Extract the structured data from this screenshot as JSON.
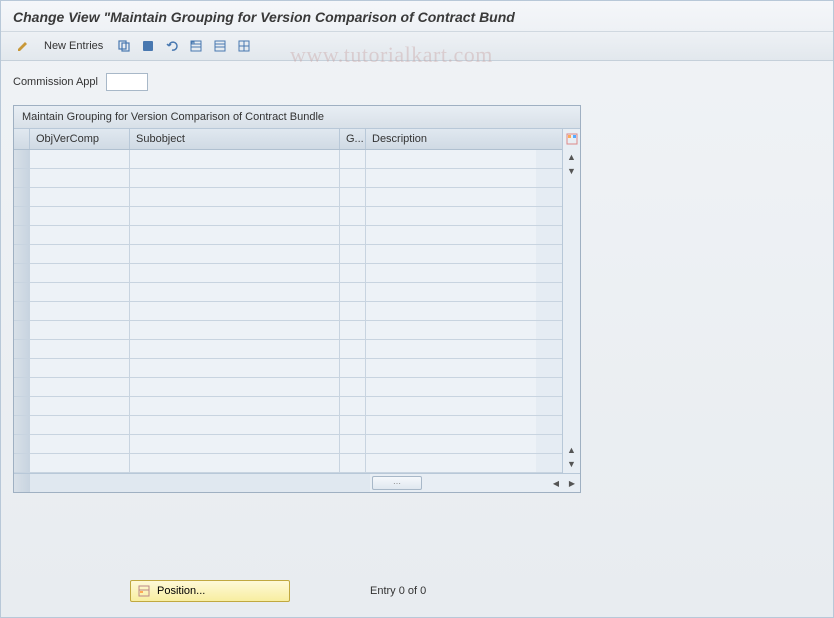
{
  "title": "Change View \"Maintain Grouping for Version Comparison of Contract Bund",
  "toolbar": {
    "new_entries_label": "New Entries"
  },
  "watermark": "www.tutorialkart.com",
  "fields": {
    "commission_appl": {
      "label": "Commission Appl",
      "value": ""
    }
  },
  "table": {
    "title": "Maintain Grouping for Version Comparison of Contract Bundle",
    "columns": [
      {
        "key": "objvercomp",
        "label": "ObjVerComp"
      },
      {
        "key": "subobject",
        "label": "Subobject"
      },
      {
        "key": "g",
        "label": "G..."
      },
      {
        "key": "description",
        "label": "Description"
      }
    ],
    "rows": [
      {},
      {},
      {},
      {},
      {},
      {},
      {},
      {},
      {},
      {},
      {},
      {},
      {},
      {},
      {},
      {},
      {}
    ]
  },
  "footer": {
    "position_label": "Position...",
    "entry_text": "Entry 0 of 0"
  }
}
